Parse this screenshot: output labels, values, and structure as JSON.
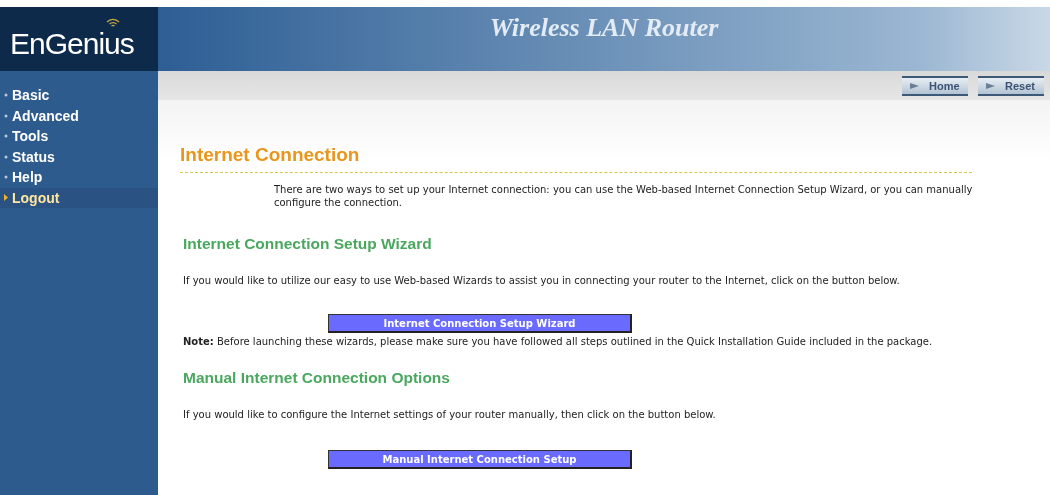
{
  "header": {
    "logo": "EnGenius",
    "title": "Wireless LAN Router"
  },
  "toolbar": {
    "buttons": [
      "Home",
      "Reset"
    ]
  },
  "sidebar": {
    "items": [
      {
        "label": "Basic",
        "selected": false
      },
      {
        "label": "Advanced",
        "selected": false
      },
      {
        "label": "Tools",
        "selected": false
      },
      {
        "label": "Status",
        "selected": false
      },
      {
        "label": "Help",
        "selected": false
      },
      {
        "label": "Logout",
        "selected": true
      }
    ]
  },
  "content": {
    "title": "Internet Connection",
    "intro": "There are two ways to set up your Internet connection: you can use the Web-based Internet Connection Setup Wizard, or you can manually configure the connection.",
    "sections": [
      {
        "heading": "Internet Connection Setup Wizard",
        "text": "If you would like to utilize our easy to use Web-based Wizards to assist you in connecting your router to the Internet, click on the button below.",
        "button": "Internet Connection Setup Wizard",
        "note": "**Note:** Before launching these wizards, please make sure you have followed all steps outlined in the Quick Installation Guide included in the package."
      },
      {
        "heading": "Manual Internet Connection Options",
        "text": "If you would like to configure the Internet settings of your router manually, then click on the button below.",
        "button": "Manual Internet Connection Setup"
      }
    ]
  }
}
